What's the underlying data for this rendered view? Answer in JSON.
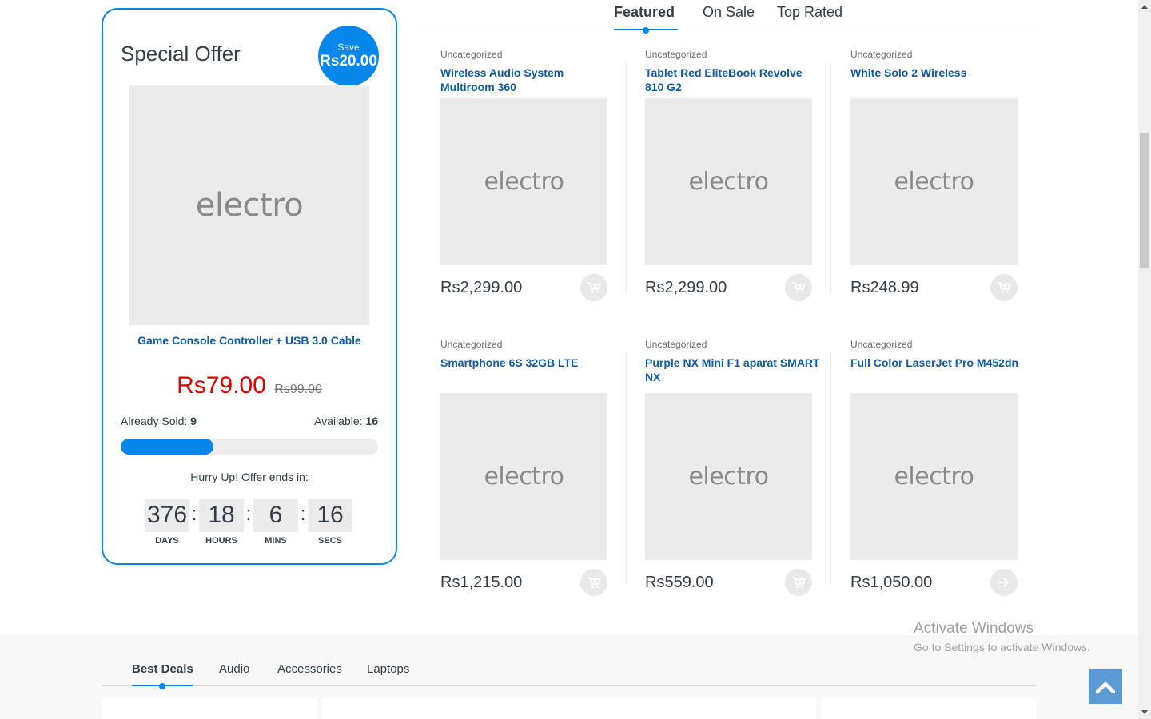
{
  "special_offer": {
    "title": "Special Offer",
    "save_label": "Save",
    "save_amount": "Rs20.00",
    "image_placeholder": "electro",
    "product_name": "Game Console Controller + USB 3.0 Cable",
    "price_new": "Rs79.00",
    "price_old": "Rs99.00",
    "sold_label": "Already Sold:",
    "sold_value": "9",
    "available_label": "Available:",
    "available_value": "16",
    "progress_percent": 36,
    "hurry_text": "Hurry Up! Offer ends in:",
    "countdown": [
      {
        "value": "376",
        "label": "DAYS"
      },
      {
        "value": "18",
        "label": "HOURS"
      },
      {
        "value": "6",
        "label": "MINS"
      },
      {
        "value": "16",
        "label": "SECS"
      }
    ],
    "separator": ":"
  },
  "product_tabs": {
    "tabs": [
      {
        "label": "Featured",
        "active": true
      },
      {
        "label": "On Sale",
        "active": false
      },
      {
        "label": "Top Rated",
        "active": false
      }
    ]
  },
  "products": [
    {
      "category": "Uncategorized",
      "name": "Wireless Audio System Multiroom 360",
      "placeholder": "electro",
      "price": "Rs2,299.00",
      "action": "cart-icon"
    },
    {
      "category": "Uncategorized",
      "name": "Tablet Red EliteBook Revolve 810 G2",
      "placeholder": "electro",
      "price": "Rs2,299.00",
      "action": "cart-icon"
    },
    {
      "category": "Uncategorized",
      "name": "White Solo 2 Wireless",
      "placeholder": "electro",
      "price": "Rs248.99",
      "action": "cart-icon"
    },
    {
      "category": "Uncategorized",
      "name": "Smartphone 6S 32GB LTE",
      "placeholder": "electro",
      "price": "Rs1,215.00",
      "action": "cart-icon"
    },
    {
      "category": "Uncategorized",
      "name": "Purple NX Mini F1 aparat SMART NX",
      "placeholder": "electro",
      "price": "Rs559.00",
      "action": "cart-icon"
    },
    {
      "category": "Uncategorized",
      "name": "Full Color LaserJet Pro M452dn",
      "placeholder": "electro",
      "price": "Rs1,050.00",
      "action": "arrow-right-icon"
    }
  ],
  "bottom_tabs": {
    "tabs": [
      {
        "label": "Best Deals",
        "active": true
      },
      {
        "label": "Audio",
        "active": false
      },
      {
        "label": "Accessories",
        "active": false
      },
      {
        "label": "Laptops",
        "active": false
      }
    ]
  },
  "windows_watermark": {
    "line1": "Activate Windows",
    "line2": "Go to Settings to activate Windows."
  },
  "colors": {
    "accent": "#0787ea",
    "link": "#0d5ba8",
    "sale_price": "#e00000",
    "scroll_top_button": "#5b9bd5"
  }
}
